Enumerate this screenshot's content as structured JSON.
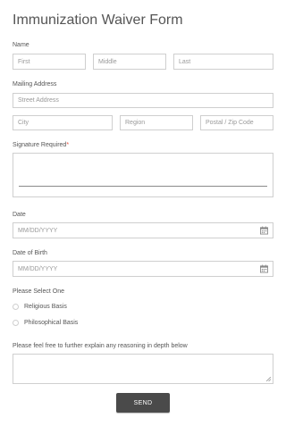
{
  "form": {
    "title": "Immunization Waiver Form",
    "name": {
      "label": "Name",
      "first_placeholder": "First",
      "middle_placeholder": "Middle",
      "last_placeholder": "Last"
    },
    "address": {
      "label": "Mailing Address",
      "street_placeholder": "Street Address",
      "city_placeholder": "City",
      "region_placeholder": "Region",
      "postal_placeholder": "Postal / Zip Code"
    },
    "signature": {
      "label": "Signature Required",
      "required_mark": "*"
    },
    "date": {
      "label": "Date",
      "placeholder": "MM/DD/YYYY"
    },
    "dob": {
      "label": "Date of Birth",
      "placeholder": "MM/DD/YYYY"
    },
    "selection": {
      "label": "Please Select One",
      "options": [
        "Religious Basis",
        "Philosophical Basis"
      ]
    },
    "explain": {
      "label": "Please feel free to further explain any reasoning in depth below"
    },
    "submit_label": "SEND"
  },
  "icons": {
    "calendar": "calendar-icon",
    "resize": "resize-handle-icon"
  },
  "colors": {
    "button_bg": "#4a4a4a",
    "required": "#e74c3c",
    "border": "#cfcfcf"
  }
}
